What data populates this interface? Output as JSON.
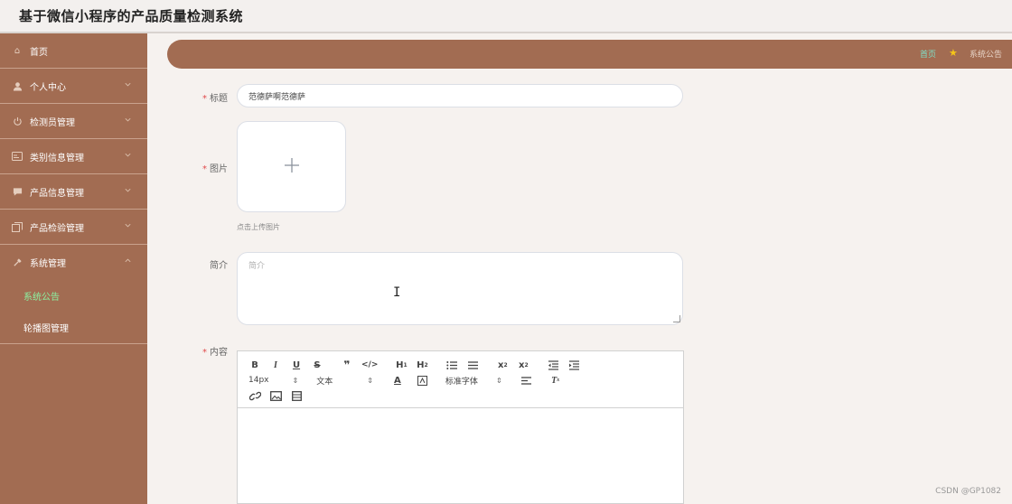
{
  "app": {
    "title": "基于微信小程序的产品质量检测系统"
  },
  "sidebar": {
    "items": [
      {
        "label": "首页",
        "icon": "home-icon"
      },
      {
        "label": "个人中心",
        "icon": "user-icon"
      },
      {
        "label": "检测员管理",
        "icon": "power-icon"
      },
      {
        "label": "类别信息管理",
        "icon": "card-icon"
      },
      {
        "label": "产品信息管理",
        "icon": "chat-icon"
      },
      {
        "label": "产品检验管理",
        "icon": "copy-icon"
      },
      {
        "label": "系统管理",
        "icon": "tools-icon"
      }
    ],
    "sub_items": [
      {
        "label": "系统公告",
        "active": true
      },
      {
        "label": "轮播图管理",
        "active": false
      }
    ]
  },
  "breadcrumb": {
    "home": "首页",
    "current": "系统公告"
  },
  "form": {
    "title_label": "标题",
    "title_value": "范德萨啊范德萨",
    "image_label": "图片",
    "upload_tip": "点击上传图片",
    "intro_label": "简介",
    "intro_placeholder": "简介",
    "content_label": "内容"
  },
  "editor": {
    "font_size": "14px",
    "paragraph": "文本",
    "font_family": "标准字体"
  },
  "watermark": "CSDN @GP1082",
  "colors": {
    "sidebar": "#a26c52",
    "active_sub": "#8cf0a0",
    "required": "#e14b4b"
  }
}
